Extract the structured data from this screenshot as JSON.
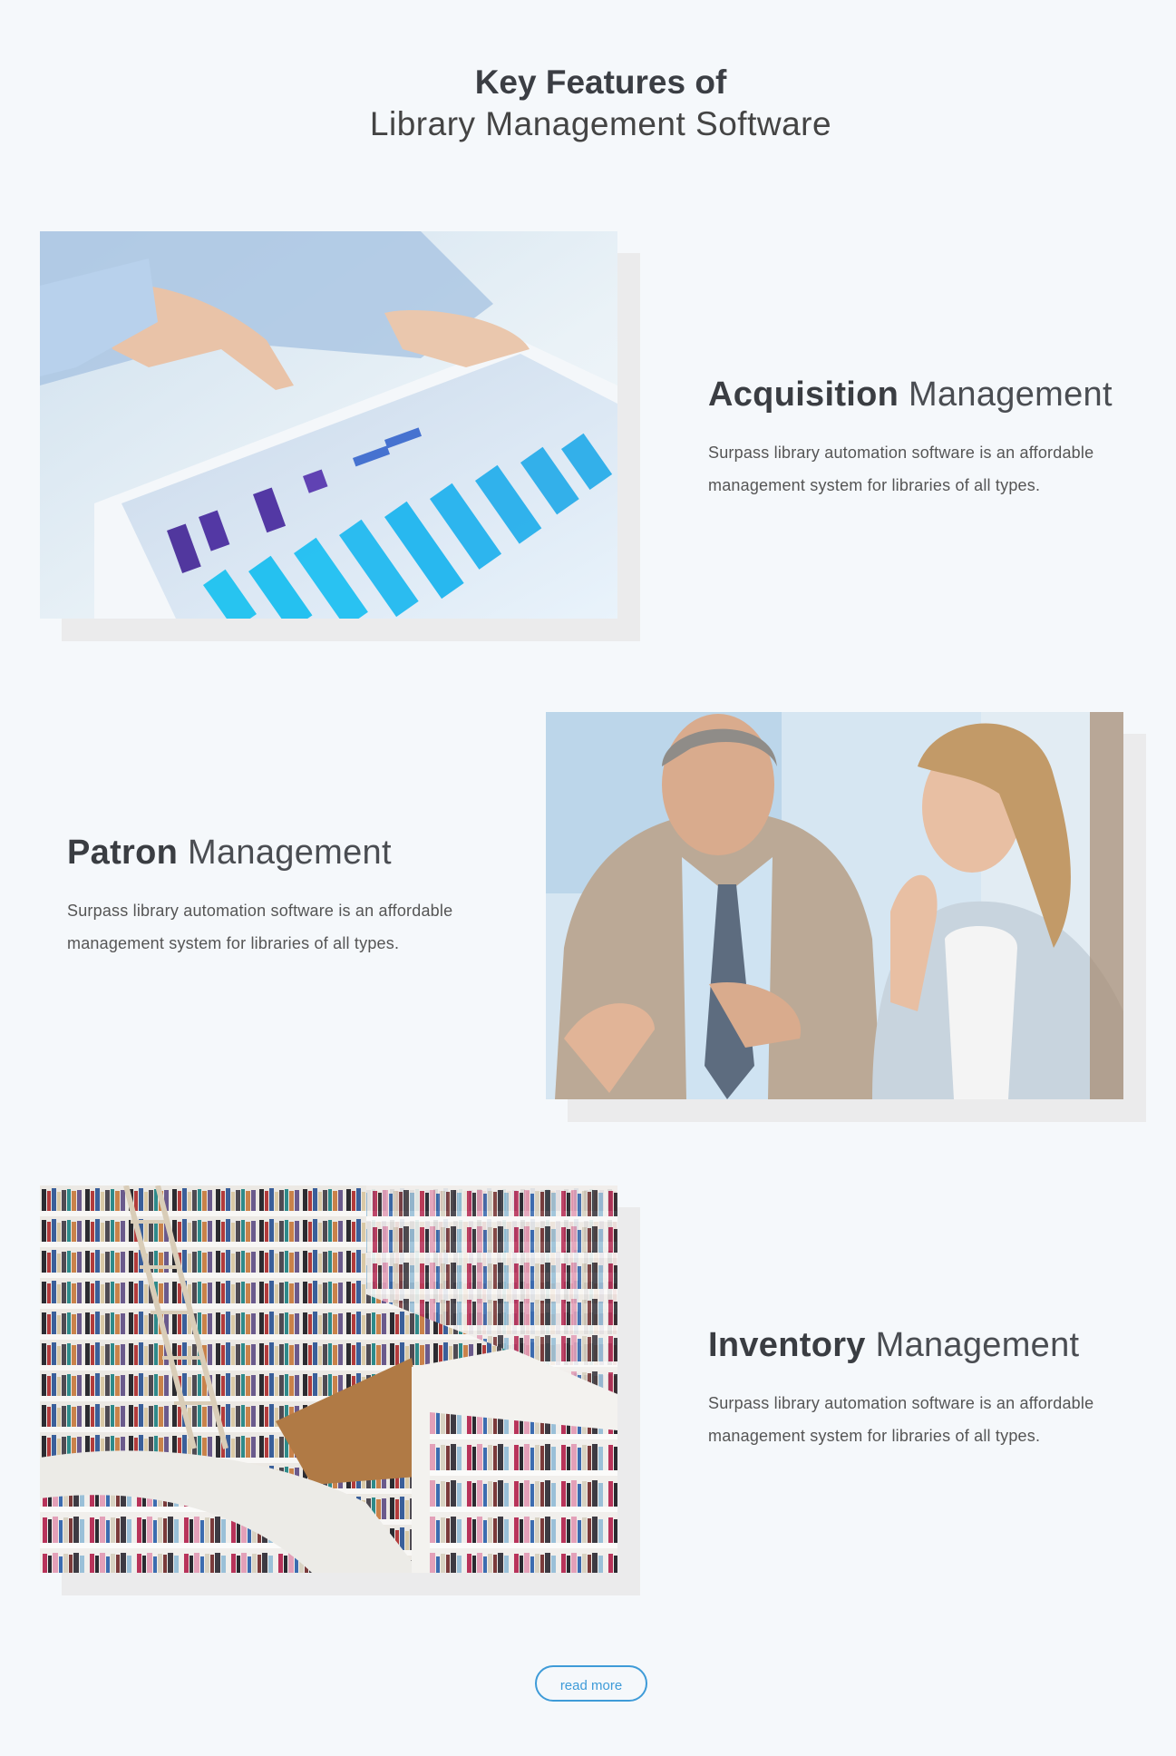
{
  "section": {
    "title_bold": "Key Features of",
    "title_light": "Library Management Software"
  },
  "features": [
    {
      "title_bold": "Acquisition",
      "title_light": "Management",
      "description": "Surpass library automation software is an affordable management system for libraries of all types.",
      "image": "tablet-bar-chart-photo"
    },
    {
      "title_bold": "Patron",
      "title_light": "Management",
      "description": "Surpass library automation software is an affordable management system for libraries of all types.",
      "image": "business-meeting-photo"
    },
    {
      "title_bold": "Inventory",
      "title_light": "Management",
      "description": "Surpass library automation software is an affordable management system for libraries of all types.",
      "image": "library-bookshelves-photo"
    }
  ],
  "read_more_label": "read more",
  "colors": {
    "background": "#f5f8fb",
    "accent": "#3e9bd8",
    "image_shadow": "#ebebec"
  }
}
